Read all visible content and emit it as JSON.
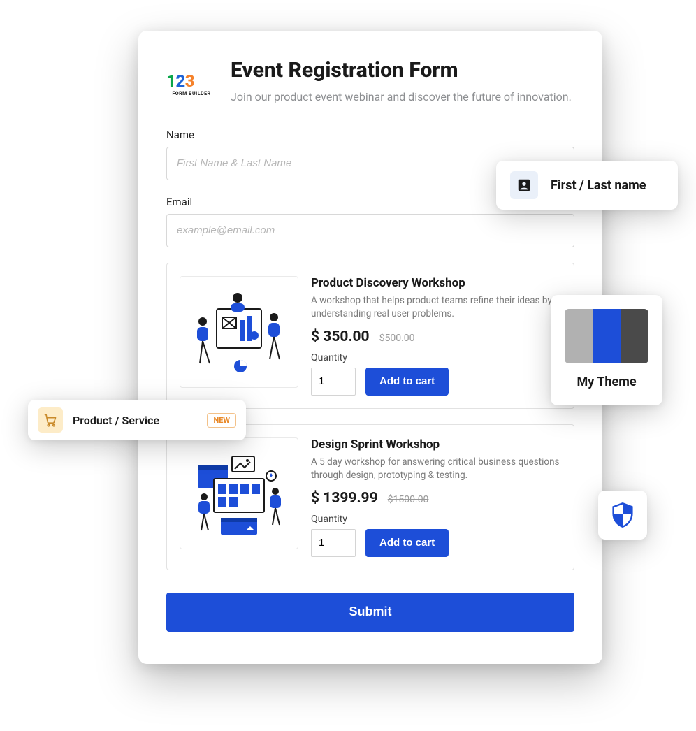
{
  "logo": {
    "number": "123",
    "subtitle": "FORM BUILDER"
  },
  "header": {
    "title": "Event Registration Form",
    "subtitle": "Join our product event webinar and discover the future of innovation."
  },
  "fields": {
    "name": {
      "label": "Name",
      "placeholder": "First Name & Last Name"
    },
    "email": {
      "label": "Email",
      "placeholder": "example@email.com"
    }
  },
  "products": [
    {
      "title": "Product Discovery Workshop",
      "description": "A workshop that helps product teams refine their ideas by understanding real user problems.",
      "price": "$ 350.00",
      "old_price": "$500.00",
      "qty_label": "Quantity",
      "qty_value": "1",
      "add_label": "Add to cart"
    },
    {
      "title": "Design Sprint Workshop",
      "description": "A 5 day workshop for answering critical business questions through design, prototyping & testing.",
      "price": "$ 1399.99",
      "old_price": "$1500.00",
      "qty_label": "Quantity",
      "qty_value": "1",
      "add_label": "Add to cart"
    }
  ],
  "submit_label": "Submit",
  "floaters": {
    "name_field": "First / Last name",
    "theme": "My Theme",
    "product_service": "Product / Service",
    "new_badge": "NEW"
  },
  "colors": {
    "primary": "#1d4ed8"
  }
}
